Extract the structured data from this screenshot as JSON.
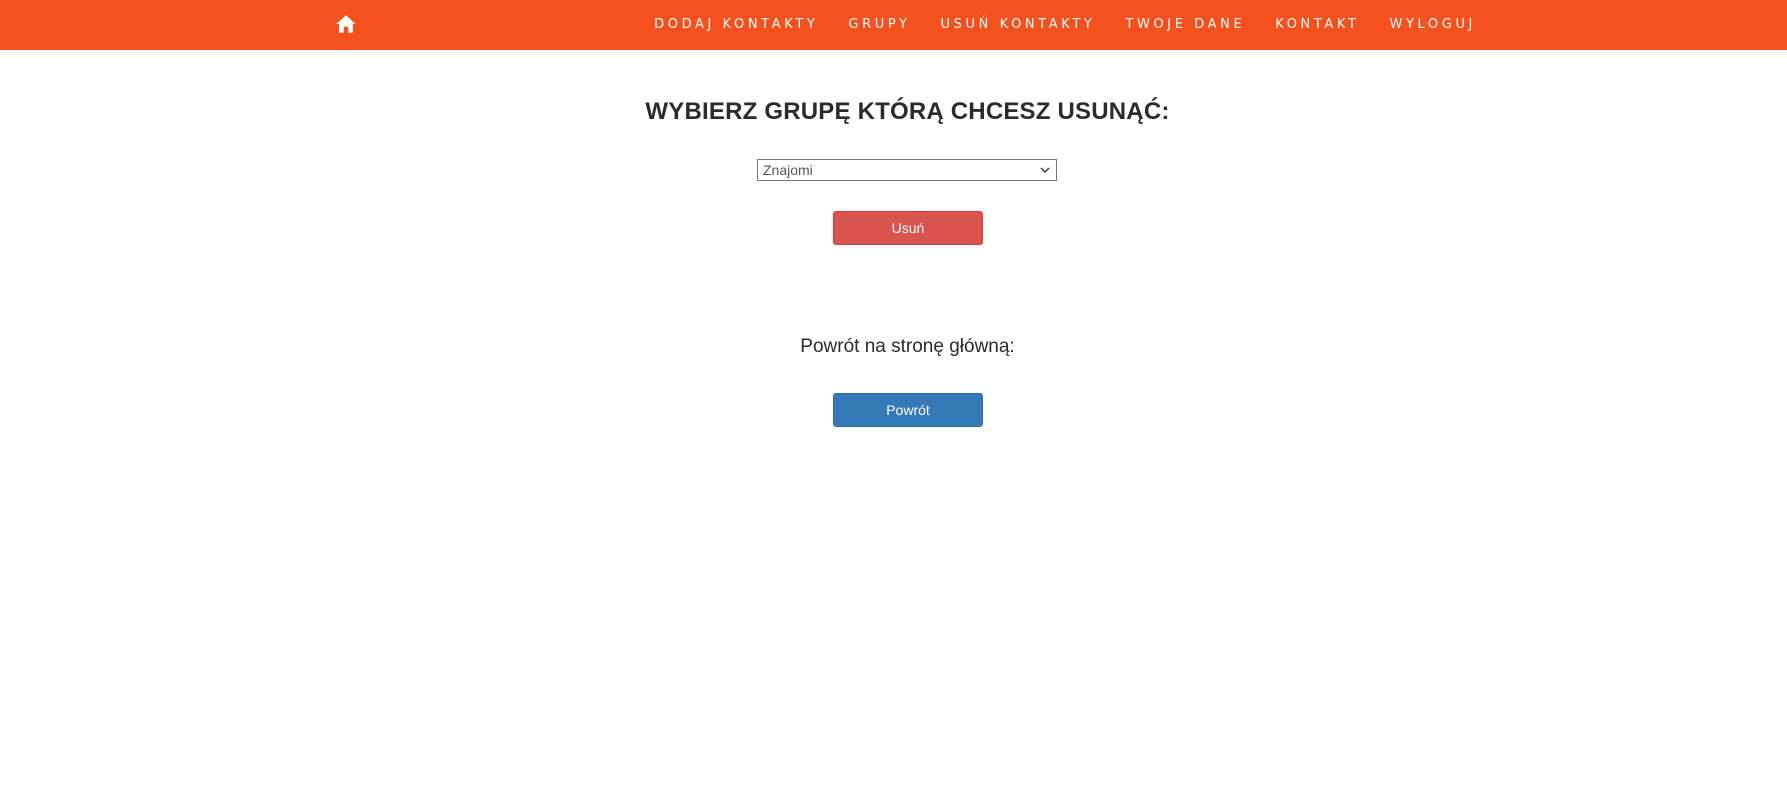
{
  "navbar": {
    "home_icon": "home-icon",
    "items": [
      {
        "label": "DODAJ KONTAKTY"
      },
      {
        "label": "GRUPY"
      },
      {
        "label": "USUŃ KONTAKTY"
      },
      {
        "label": "TWOJE DANE"
      },
      {
        "label": "KONTAKT"
      },
      {
        "label": "WYLOGUJ"
      }
    ]
  },
  "main": {
    "title": "WYBIERZ GRUPĘ KTÓRĄ CHCESZ USUNĄĆ:",
    "group_select": {
      "selected": "Znajomi"
    },
    "delete_button": "Usuń",
    "back_label": "Powrót na stronę główną:",
    "back_button": "Powrót"
  },
  "colors": {
    "navbar": "#f4511e",
    "delete": "#d9534f",
    "back": "#337ab7"
  }
}
